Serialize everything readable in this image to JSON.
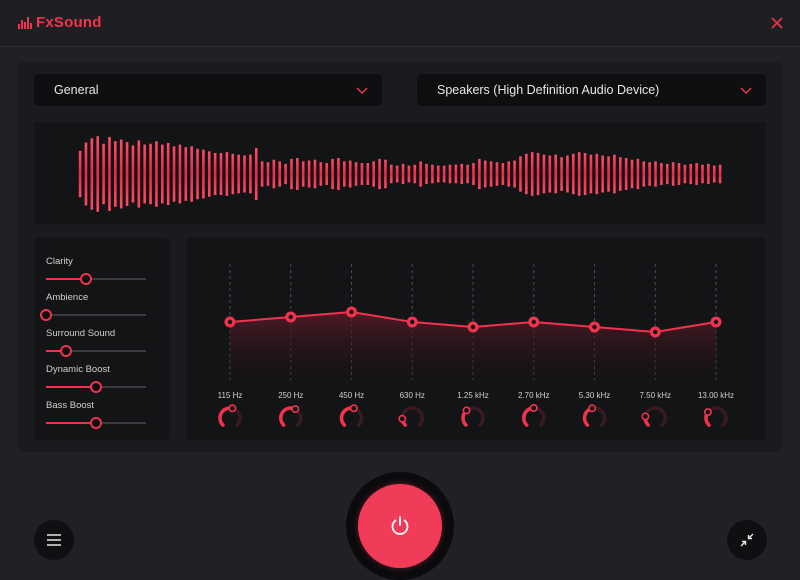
{
  "app": {
    "name": "FxSound",
    "accent_color": "#f2334e"
  },
  "header": {
    "close_icon": "close-x-icon"
  },
  "controls": {
    "preset": {
      "selected": "General"
    },
    "output_device": {
      "selected": "Speakers (High Definition Audio Device)"
    }
  },
  "visualizer": {
    "levels": [
      0.55,
      0.75,
      0.85,
      0.9,
      0.72,
      0.88,
      0.78,
      0.82,
      0.76,
      0.68,
      0.8,
      0.7,
      0.72,
      0.78,
      0.7,
      0.74,
      0.66,
      0.7,
      0.64,
      0.66,
      0.6,
      0.58,
      0.54,
      0.5,
      0.5,
      0.52,
      0.48,
      0.46,
      0.44,
      0.46,
      0.62,
      0.3,
      0.28,
      0.34,
      0.3,
      0.24,
      0.36,
      0.38,
      0.3,
      0.32,
      0.34,
      0.28,
      0.26,
      0.36,
      0.38,
      0.3,
      0.32,
      0.28,
      0.26,
      0.26,
      0.3,
      0.36,
      0.34,
      0.22,
      0.2,
      0.24,
      0.2,
      0.22,
      0.3,
      0.24,
      0.22,
      0.2,
      0.2,
      0.22,
      0.22,
      0.24,
      0.22,
      0.26,
      0.36,
      0.32,
      0.3,
      0.28,
      0.26,
      0.3,
      0.32,
      0.42,
      0.48,
      0.52,
      0.5,
      0.46,
      0.44,
      0.46,
      0.4,
      0.44,
      0.48,
      0.52,
      0.5,
      0.46,
      0.48,
      0.44,
      0.42,
      0.46,
      0.4,
      0.38,
      0.34,
      0.36,
      0.3,
      0.28,
      0.3,
      0.26,
      0.24,
      0.28,
      0.26,
      0.22,
      0.24,
      0.26,
      0.22,
      0.24,
      0.2,
      0.22
    ]
  },
  "effects": [
    {
      "label": "Clarity",
      "value": 0.4
    },
    {
      "label": "Ambience",
      "value": 0.0
    },
    {
      "label": "Surround Sound",
      "value": 0.2
    },
    {
      "label": "Dynamic Boost",
      "value": 0.5
    },
    {
      "label": "Bass Boost",
      "value": 0.5
    }
  ],
  "equalizer": {
    "bands": [
      {
        "label": "115 Hz",
        "gain": 0.0,
        "knob": 0.55
      },
      {
        "label": "250 Hz",
        "gain": 0.1,
        "knob": 0.6
      },
      {
        "label": "450 Hz",
        "gain": 0.2,
        "knob": 0.55
      },
      {
        "label": "630 Hz",
        "gain": 0.0,
        "knob": 0.15
      },
      {
        "label": "1.25 kHz",
        "gain": -0.1,
        "knob": 0.35
      },
      {
        "label": "2.70 kHz",
        "gain": 0.0,
        "knob": 0.5
      },
      {
        "label": "5.30 kHz",
        "gain": -0.1,
        "knob": 0.45
      },
      {
        "label": "7.50 kHz",
        "gain": -0.2,
        "knob": 0.2
      },
      {
        "label": "13.00 kHz",
        "gain": 0.0,
        "knob": 0.3
      }
    ]
  },
  "footer": {
    "menu_icon": "hamburger-menu-icon",
    "power_icon": "power-icon",
    "minimize_icon": "compress-arrows-icon"
  }
}
